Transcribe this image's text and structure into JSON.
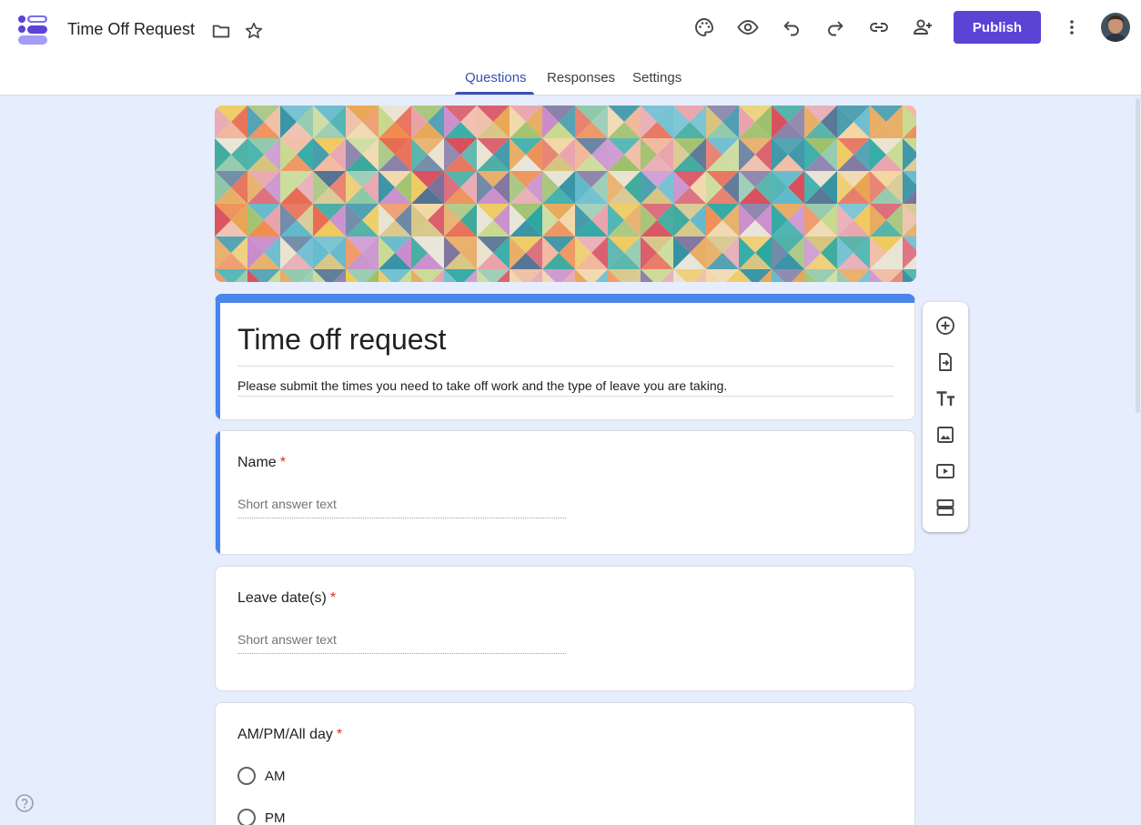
{
  "app": {
    "logo_icon": "forms-logo-icon",
    "accent_color": "#5b43d6"
  },
  "doc": {
    "title": "Time Off Request"
  },
  "toolbar": {
    "icons": [
      "palette-icon",
      "eye-icon",
      "undo-icon",
      "redo-icon",
      "link-icon",
      "add-person-icon",
      "more-vert-icon"
    ],
    "publish_label": "Publish"
  },
  "tabs": [
    {
      "label": "Questions",
      "active": true
    },
    {
      "label": "Responses",
      "active": false
    },
    {
      "label": "Settings",
      "active": false
    }
  ],
  "form": {
    "title": "Time off request",
    "description": "Please submit the times you need to take off work and the type of leave you are taking.",
    "header_color": "#4a86e8",
    "questions": [
      {
        "title": "Name",
        "required_mark": "*",
        "placeholder": "Short answer text"
      },
      {
        "title": "Leave date(s)",
        "required_mark": "*",
        "placeholder": "Short answer text"
      },
      {
        "title": "AM/PM/All day",
        "required_mark": "*",
        "options": [
          "AM",
          "PM"
        ]
      }
    ]
  },
  "side_toolbar": [
    "add-question-icon",
    "import-questions-icon",
    "add-title-icon",
    "add-image-icon",
    "add-video-icon",
    "add-section-icon"
  ]
}
